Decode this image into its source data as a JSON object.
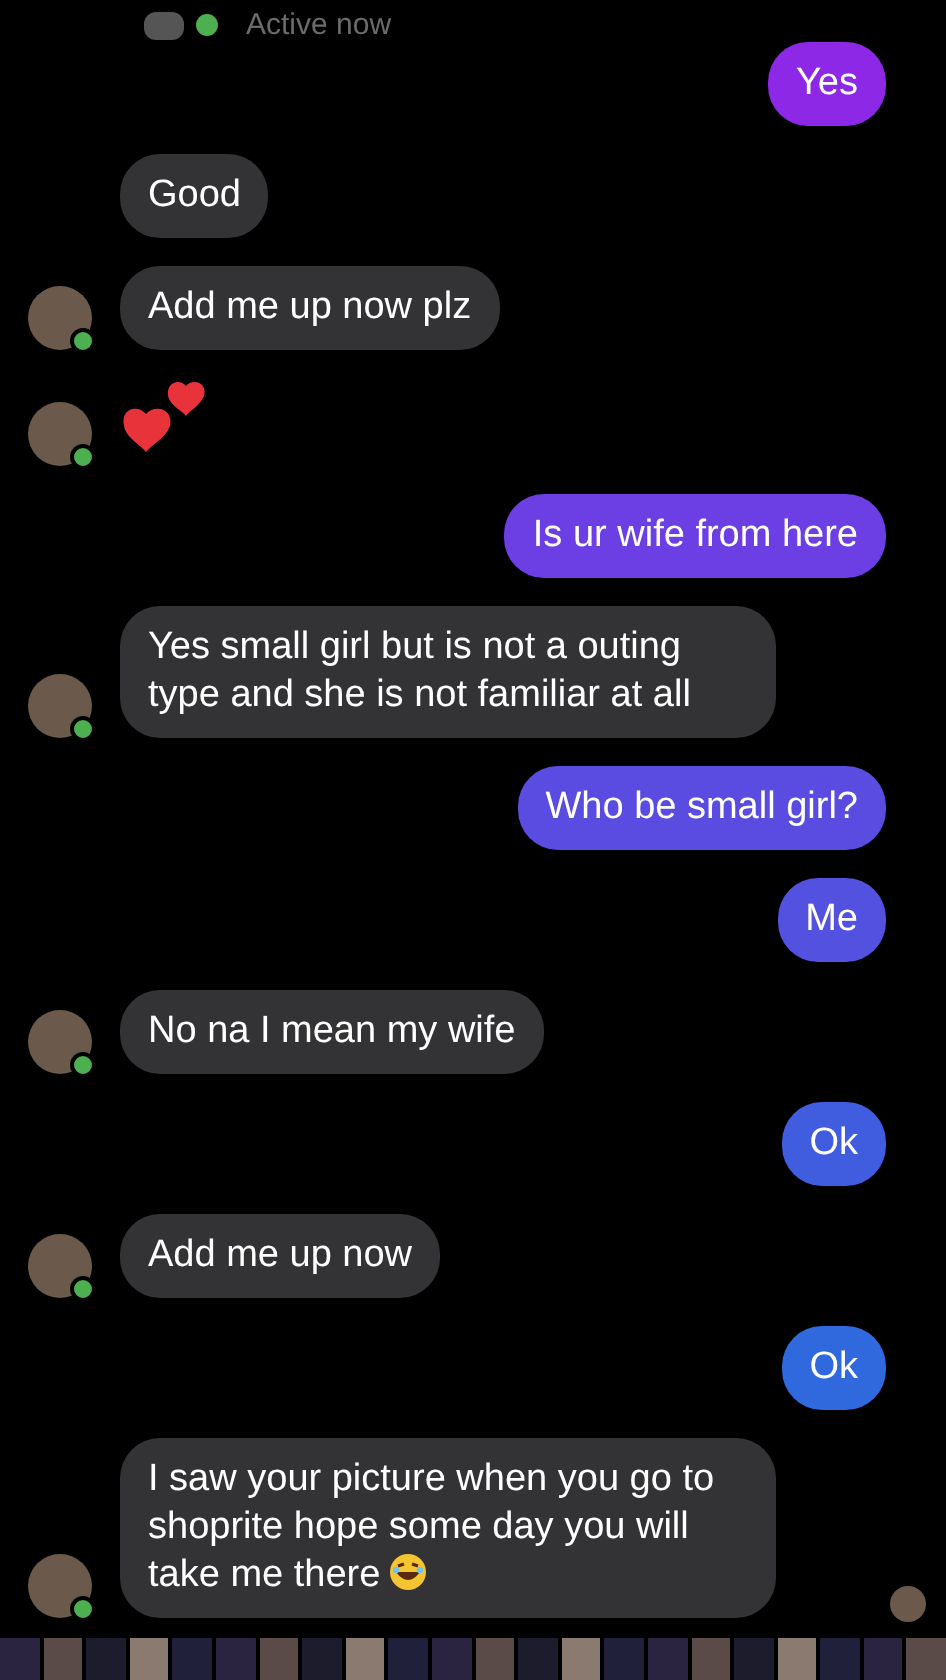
{
  "header": {
    "status": "Active now"
  },
  "messages": [
    {
      "kind": "sent",
      "text": "Yes"
    },
    {
      "kind": "received",
      "text": "Good",
      "avatar": false
    },
    {
      "kind": "received",
      "text": "Add me up now plz",
      "avatar": true
    },
    {
      "kind": "hearts",
      "avatar": true
    },
    {
      "kind": "sent",
      "text": "Is ur wife from here"
    },
    {
      "kind": "received",
      "text": "Yes small girl but is not a outing type and she is not familiar at all",
      "avatar": true
    },
    {
      "kind": "sent",
      "text": "Who be small girl?"
    },
    {
      "kind": "sent",
      "text": "Me"
    },
    {
      "kind": "received",
      "text": "No na I mean my wife",
      "avatar": true
    },
    {
      "kind": "sent",
      "text": "Ok"
    },
    {
      "kind": "received",
      "text": "Add me up now",
      "avatar": true
    },
    {
      "kind": "sent",
      "text": "Ok"
    },
    {
      "kind": "received",
      "text": "I saw your picture when you go to shoprite hope some day you will take me there",
      "avatar": true,
      "laughing_emoji": true
    }
  ],
  "seen_avatar": true
}
